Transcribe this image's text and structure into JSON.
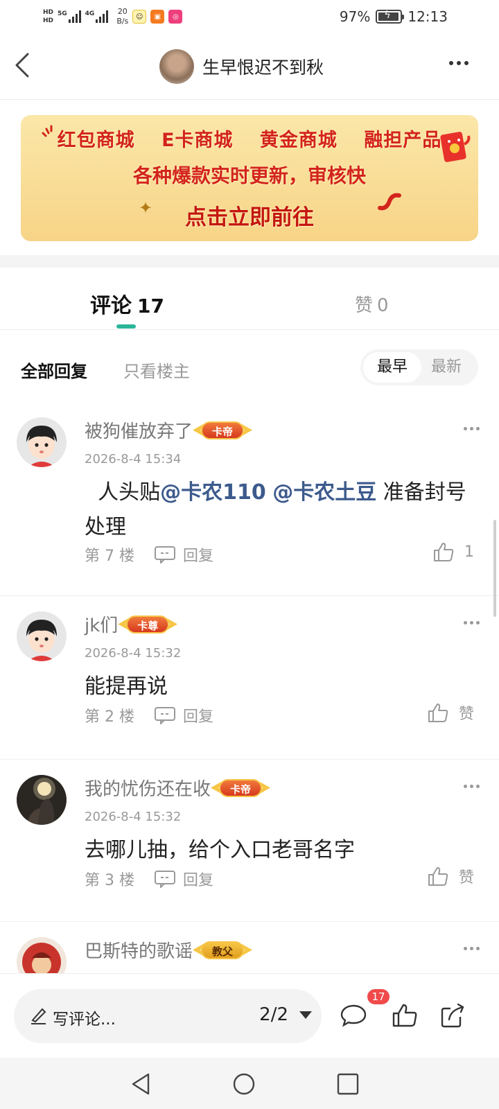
{
  "status_bar": {
    "hd1": "HD",
    "hd2": "HD",
    "net1": "5G",
    "net2": "4G",
    "speed_value": "20",
    "speed_unit": "B/s",
    "battery": "97%",
    "battery_level": 0.97,
    "time": "12:13"
  },
  "header": {
    "title": "生早恨迟不到秋"
  },
  "banner": {
    "line1": "红包商城  E卡商城  黄金商城  融担产品",
    "line2": "各种爆款实时更新，审核快",
    "line3": "点击立即前往"
  },
  "tabs": {
    "comment_label": "评论",
    "comment_count": "17",
    "like_label": "赞",
    "like_count": "0"
  },
  "filter": {
    "all": "全部回复",
    "owner_only": "只看楼主",
    "sort_earliest": "最早",
    "sort_latest": "最新"
  },
  "comments": [
    {
      "name": "被狗催放弃了",
      "badge": "卡帝",
      "time": "2026-8-4 15:34",
      "text_pre": "  人头贴",
      "mention1": "@卡农110",
      "mention2": "@卡农土豆",
      "text_post": " 准备封号处理",
      "floor": "第 7 楼",
      "reply": "回复",
      "likes": "1"
    },
    {
      "name": "jk们",
      "badge": "卡尊",
      "time": "2026-8-4 15:32",
      "text": "能提再说",
      "floor": "第 2 楼",
      "reply": "回复",
      "likes": "赞"
    },
    {
      "name": "我的忧伤还在收",
      "badge": "卡帝",
      "time": "2026-8-4 15:32",
      "text": "去哪儿抽，给个入口老哥名字",
      "floor": "第 3 楼",
      "reply": "回复",
      "likes": "赞"
    },
    {
      "name": "巴斯特的歌谣",
      "badge": "教父"
    }
  ],
  "bottom_bar": {
    "placeholder": "写评论...",
    "page": "2/2",
    "comment_badge": "17"
  }
}
